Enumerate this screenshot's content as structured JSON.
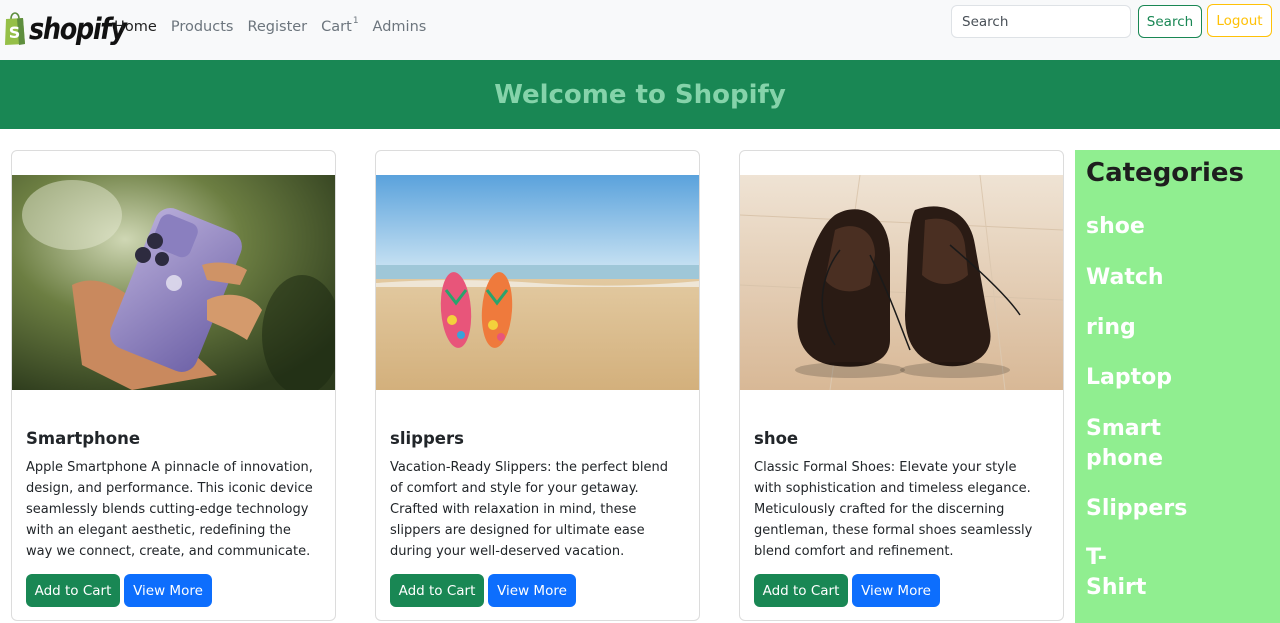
{
  "navbar": {
    "brand_text": "shopify",
    "links": [
      {
        "label": "Home",
        "active": true
      },
      {
        "label": "Products"
      },
      {
        "label": "Register"
      },
      {
        "label": "Cart"
      },
      {
        "label": "Admins"
      }
    ],
    "cart_count": "1",
    "search_placeholder": "Search",
    "search_button": "Search",
    "logout_button": "Logout"
  },
  "hero": {
    "title": "Welcome to Shopify"
  },
  "products": [
    {
      "title": "Smartphone",
      "description": "Apple Smartphone A pinnacle of innovation, design, and performance. This iconic device seamlessly blends cutting-edge technology with an elegant aesthetic, redefining the way we connect, create, and communicate.",
      "add_to_cart": "Add to Cart",
      "view_more": "View More"
    },
    {
      "title": "slippers",
      "description": "Vacation-Ready Slippers: the perfect blend of comfort and style for your getaway. Crafted with relaxation in mind, these slippers are designed for ultimate ease during your well-deserved vacation.",
      "add_to_cart": "Add to Cart",
      "view_more": "View More"
    },
    {
      "title": "shoe",
      "description": "Classic Formal Shoes: Elevate your style with sophistication and timeless elegance. Meticulously crafted for the discerning gentleman, these formal shoes seamlessly blend comfort and refinement.",
      "add_to_cart": "Add to Cart",
      "view_more": "View More"
    }
  ],
  "sidebar": {
    "title": "Categories",
    "items": [
      "shoe",
      "Watch",
      "ring",
      "Laptop",
      "Smart phone",
      "Slippers",
      "T-Shirt"
    ]
  },
  "colors": {
    "primary_green": "#198754",
    "hero_text": "#85d3aa",
    "primary_blue": "#0d6efd",
    "warning": "#ffc107",
    "sidebar_bg": "#90ee90"
  },
  "icons": [
    "shopify-bag-icon"
  ]
}
